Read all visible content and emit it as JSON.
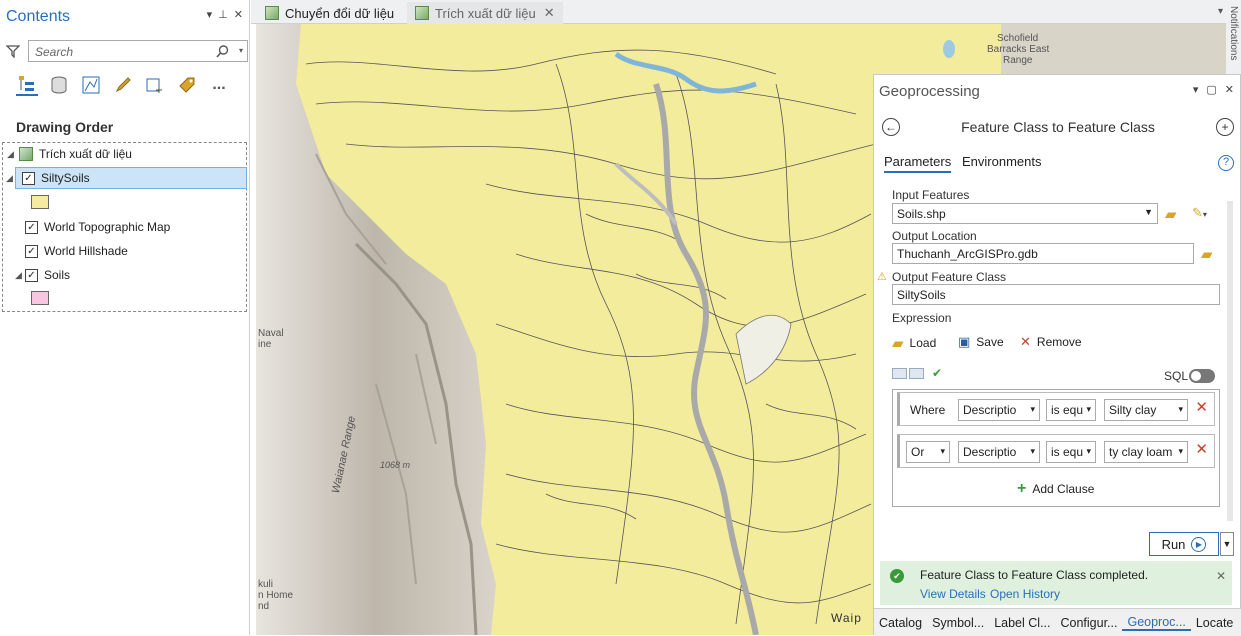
{
  "contents": {
    "title": "Contents",
    "search_placeholder": "Search",
    "drawing_order": "Drawing Order",
    "more": "...",
    "layers": {
      "map": "Trích xuất dữ liệu",
      "silty": "SiltySoils",
      "topo": "World Topographic Map",
      "hill": "World Hillshade",
      "soils": "Soils"
    },
    "swatch_colors": {
      "silty": "#f4eaa0",
      "soils": "#f7c6e0"
    }
  },
  "tabs": [
    {
      "label": "Chuyển đổi dữ liệu"
    },
    {
      "label": "Trích xuất dữ liệu"
    }
  ],
  "map": {
    "labels": {
      "schofield": "Schofield",
      "barracks": "Barracks East",
      "range": "Range",
      "naval": "Naval",
      "naval2": "ine",
      "waianae": "Waianae Range",
      "elev": "1068 m",
      "kuli": "kuli",
      "home": "n Home",
      "nd": "nd",
      "waip": "Waip"
    },
    "colors": {
      "soil_fill": "#f3ec9c",
      "hillshade": "#cfc9c0"
    }
  },
  "geo": {
    "title": "Geoprocessing",
    "tool_title": "Feature Class to Feature Class",
    "tab_parameters": "Parameters",
    "tab_environments": "Environments",
    "help": "?",
    "input_features_label": "Input Features",
    "input_features_value": "Soils.shp",
    "output_location_label": "Output Location",
    "output_location_value": "Thuchanh_ArcGISPro.gdb",
    "output_fc_label": "Output Feature Class",
    "output_fc_value": "SiltySoils",
    "expression_label": "Expression",
    "load": "Load",
    "save": "Save",
    "remove": "Remove",
    "sql": "SQL",
    "clauses": [
      {
        "conj": "Where",
        "field": "Descriptio",
        "op": "is equ",
        "value": "Silty clay"
      },
      {
        "conj": "Or",
        "field": "Descriptio",
        "op": "is equ",
        "value": "ty clay loam"
      }
    ],
    "add_clause": "Add Clause",
    "run": "Run",
    "message": "Feature Class to Feature Class completed.",
    "view_details": "View Details",
    "open_history": "Open History",
    "bottom_tabs": [
      "Catalog",
      "Symbol...",
      "Label Cl...",
      "Configur...",
      "Geoproc...",
      "Locate"
    ]
  },
  "side_label": "Notifications"
}
